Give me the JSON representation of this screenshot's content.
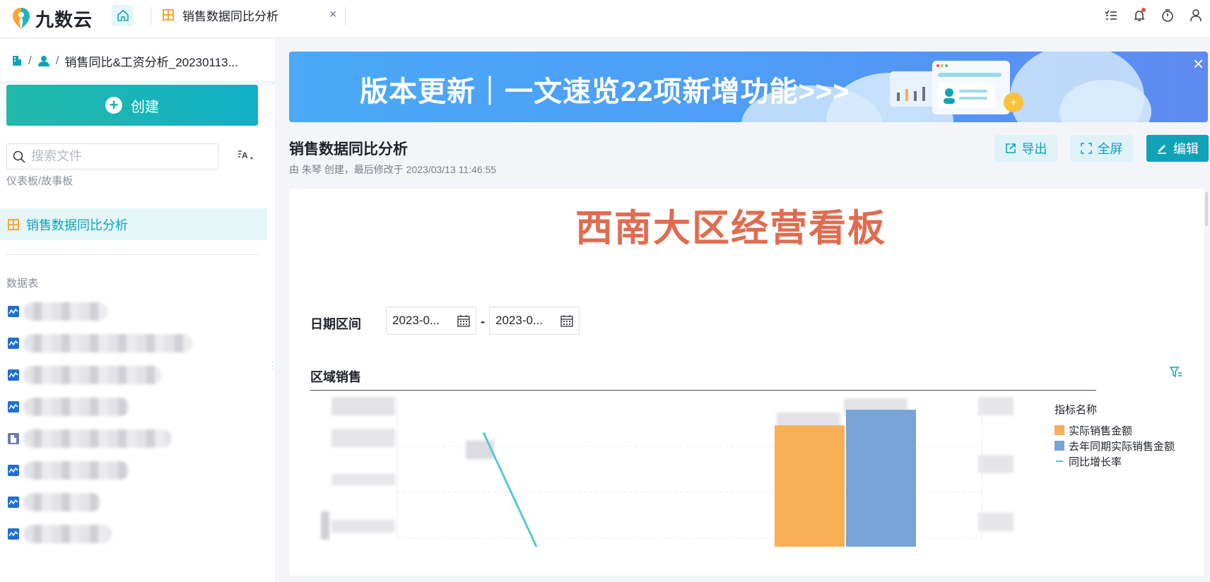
{
  "app": {
    "logo_text": "九数云",
    "tab_label": "销售数据同比分析",
    "tab_close": "×"
  },
  "sidebar": {
    "breadcrumb_sep": "/",
    "breadcrumb_text": "销售同比&工资分析_20230113...",
    "create_label": "创建",
    "search_placeholder": "搜索文件",
    "sort_label": "A",
    "section_dashboards": "仪表板/故事板",
    "active_item": "销售数据同比分析",
    "section_tables": "数据表"
  },
  "banner": {
    "text": "版本更新｜一文速览22项新增功能>>>",
    "close": "×"
  },
  "header": {
    "title": "销售数据同比分析",
    "subtitle": "由 朱琴 创建，最后修改于 2023/03/13 11:46:55",
    "export_label": "导出",
    "fullscreen_label": "全屏",
    "edit_label": "编辑"
  },
  "board": {
    "title": "西南大区经营看板",
    "date_label": "日期区间",
    "date_start": "2023-0...",
    "date_end": "2023-0...",
    "date_dash": "-",
    "chart_title": "区域销售"
  },
  "chart_data": {
    "type": "bar",
    "legend_title": "指标名称",
    "series": [
      {
        "name": "实际销售金额",
        "type": "bar",
        "color": "#f7ae54",
        "values": [
          0.85
        ]
      },
      {
        "name": "去年同期实际销售金额",
        "type": "bar",
        "color": "#78a3d6",
        "values": [
          0.96
        ]
      },
      {
        "name": "同比增长率",
        "type": "line",
        "color": "#5ac7d7",
        "values": [
          0.8,
          0.0
        ]
      }
    ]
  },
  "colors": {
    "accent": "#10a3b8",
    "board_title": "#e06c4f"
  }
}
